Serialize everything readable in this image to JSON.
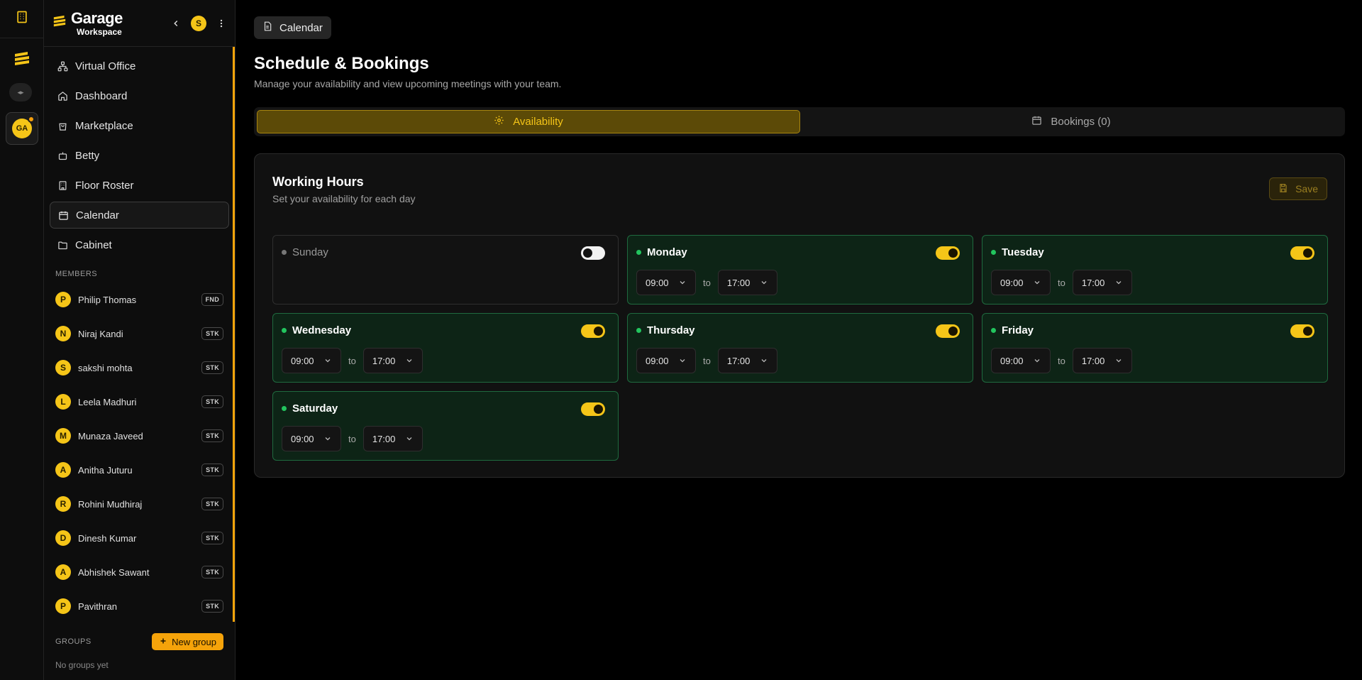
{
  "sidebar": {
    "brand_name": "Garage",
    "brand_sub": "Workspace",
    "user_initial": "S",
    "nav": [
      {
        "label": "Virtual Office",
        "icon": "network-icon"
      },
      {
        "label": "Dashboard",
        "icon": "home-icon"
      },
      {
        "label": "Marketplace",
        "icon": "shopping-bag-icon"
      },
      {
        "label": "Betty",
        "icon": "bot-icon"
      },
      {
        "label": "Floor Roster",
        "icon": "building-icon"
      },
      {
        "label": "Calendar",
        "icon": "calendar-icon",
        "active": true
      },
      {
        "label": "Cabinet",
        "icon": "folder-icon"
      }
    ],
    "members_label": "MEMBERS",
    "members": [
      {
        "initial": "P",
        "name": "Philip Thomas",
        "badge": "FND"
      },
      {
        "initial": "N",
        "name": "Niraj Kandi",
        "badge": "STK"
      },
      {
        "initial": "S",
        "name": "sakshi mohta",
        "badge": "STK"
      },
      {
        "initial": "L",
        "name": "Leela Madhuri",
        "badge": "STK"
      },
      {
        "initial": "M",
        "name": "Munaza Javeed",
        "badge": "STK"
      },
      {
        "initial": "A",
        "name": "Anitha Juturu",
        "badge": "STK"
      },
      {
        "initial": "R",
        "name": "Rohini Mudhiraj",
        "badge": "STK"
      },
      {
        "initial": "D",
        "name": "Dinesh Kumar",
        "badge": "STK"
      },
      {
        "initial": "A",
        "name": "Abhishek Sawant",
        "badge": "STK"
      },
      {
        "initial": "P",
        "name": "Pavithran",
        "badge": "STK"
      }
    ],
    "groups_label": "GROUPS",
    "new_group_label": "New group",
    "no_groups": "No groups yet"
  },
  "rail": {
    "workspace_initials": "GA"
  },
  "main": {
    "breadcrumb": "Calendar",
    "title": "Schedule & Bookings",
    "subtitle": "Manage your availability and view upcoming meetings with your team.",
    "tabs": [
      {
        "label": "Availability",
        "active": true
      },
      {
        "label": "Bookings (0)",
        "active": false
      }
    ],
    "working_hours": {
      "title": "Working Hours",
      "subtitle": "Set your availability for each day",
      "save_label": "Save",
      "to_label": "to",
      "days": [
        {
          "name": "Sunday",
          "enabled": false,
          "start": "",
          "end": ""
        },
        {
          "name": "Monday",
          "enabled": true,
          "start": "09:00",
          "end": "17:00"
        },
        {
          "name": "Tuesday",
          "enabled": true,
          "start": "09:00",
          "end": "17:00"
        },
        {
          "name": "Wednesday",
          "enabled": true,
          "start": "09:00",
          "end": "17:00"
        },
        {
          "name": "Thursday",
          "enabled": true,
          "start": "09:00",
          "end": "17:00"
        },
        {
          "name": "Friday",
          "enabled": true,
          "start": "09:00",
          "end": "17:00"
        },
        {
          "name": "Saturday",
          "enabled": true,
          "start": "09:00",
          "end": "17:00"
        }
      ]
    }
  },
  "colors": {
    "accent": "#f5c518",
    "accent_orange": "#f5a30a",
    "enabled_green": "#22c55e",
    "enabled_bg": "#0d2416"
  }
}
